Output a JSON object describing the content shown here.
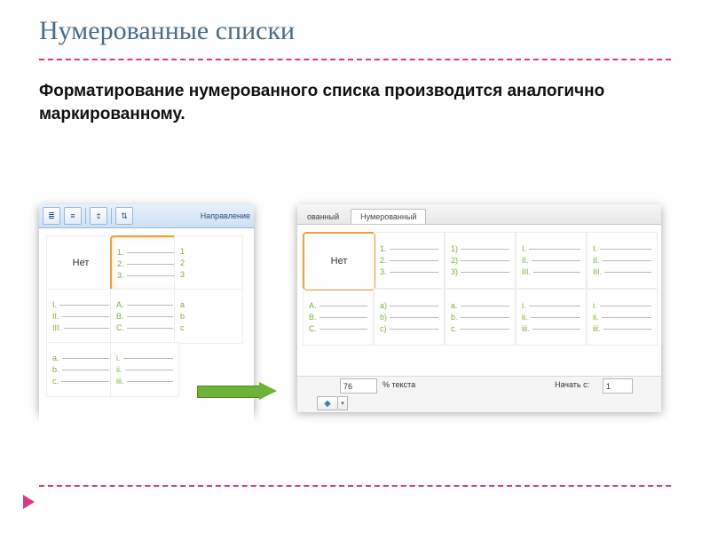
{
  "title": "Нумерованные списки",
  "body": "Форматирование нумерованного списка производится аналогично маркированному.",
  "left": {
    "ribbon_label": "Направление",
    "none": "Нет",
    "styles": {
      "arabic_dot": [
        "1.",
        "2.",
        "3."
      ],
      "arabic_dot_edge": [
        "1",
        "2",
        "3"
      ],
      "roman_upper": [
        "I.",
        "II.",
        "III."
      ],
      "latin_upper": [
        "A.",
        "B.",
        "C."
      ],
      "latin_lower_edge": [
        "a",
        "b",
        "c"
      ],
      "latin_lower_dot": [
        "a.",
        "b.",
        "c."
      ],
      "roman_lower_dot": [
        "i.",
        "ii.",
        "iii."
      ]
    }
  },
  "right": {
    "tab_inactive": "ованный",
    "tab_active": "Нумерованный",
    "none": "Нет",
    "styles": {
      "arabic_dot": [
        "1.",
        "2.",
        "3."
      ],
      "arabic_paren": [
        "1)",
        "2)",
        "3)"
      ],
      "roman_upper": [
        "I.",
        "II.",
        "III."
      ],
      "latin_upper_edge": [
        "A.",
        "B.",
        "C."
      ],
      "latin_lower_paren": [
        "a)",
        "b)",
        "c)"
      ],
      "latin_lower_dot": [
        "a.",
        "b.",
        "c."
      ],
      "roman_lower_dot": [
        "i.",
        "ii.",
        "iii."
      ]
    },
    "footer": {
      "size_value": "76",
      "size_label": "% текста",
      "start_label": "Начать с:",
      "start_value": "1",
      "dropdown_glyph": "▾",
      "color_glyph": "◆"
    }
  }
}
